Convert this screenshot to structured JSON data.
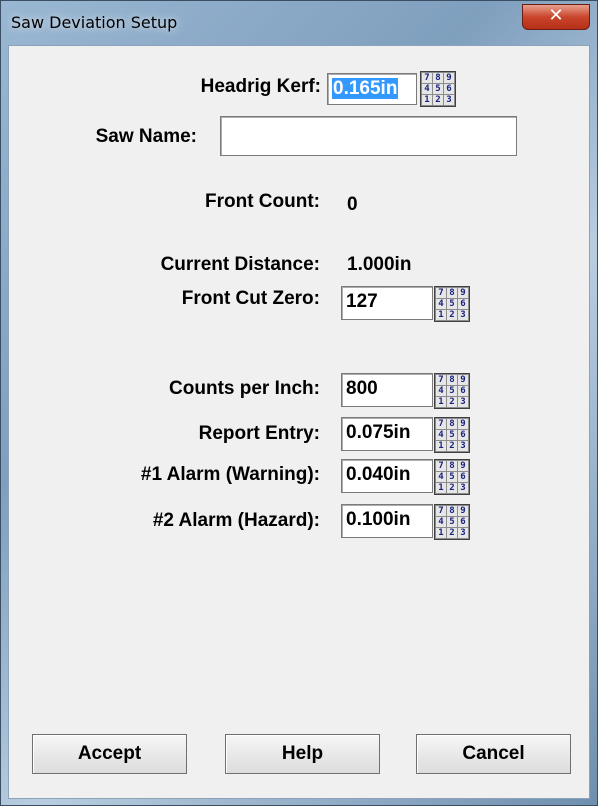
{
  "window": {
    "title": "Saw Deviation Setup",
    "close_glyph": "✕"
  },
  "form": {
    "headrig_kerf": {
      "label": "Headrig Kerf:",
      "value": "0.165in"
    },
    "saw_name": {
      "label": "Saw Name:",
      "value": ""
    },
    "front_count": {
      "label": "Front Count:",
      "value": "0"
    },
    "current_distance": {
      "label": "Current Distance:",
      "value": "1.000in"
    },
    "front_cut_zero": {
      "label": "Front Cut Zero:",
      "value": "127"
    },
    "counts_per_inch": {
      "label": "Counts per Inch:",
      "value": "800"
    },
    "report_entry": {
      "label": "Report Entry:",
      "value": "0.075in"
    },
    "alarm1": {
      "label": "#1 Alarm (Warning):",
      "value": "0.040in"
    },
    "alarm2": {
      "label": "#2 Alarm (Hazard):",
      "value": "0.100in"
    }
  },
  "keypad": {
    "icon": "numeric-keypad-icon",
    "keys": [
      "7",
      "8",
      "9",
      "4",
      "5",
      "6",
      "1",
      "2",
      "3"
    ]
  },
  "buttons": {
    "accept": "Accept",
    "help": "Help",
    "cancel": "Cancel"
  }
}
